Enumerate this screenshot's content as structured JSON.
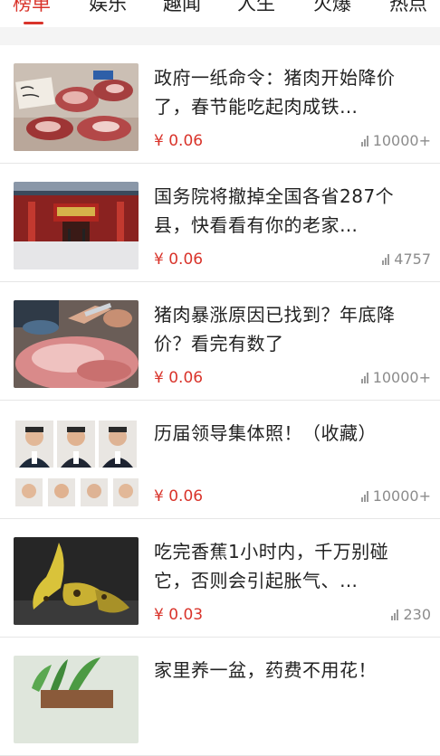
{
  "tabs": [
    {
      "label": "榜单",
      "active": true
    },
    {
      "label": "娱乐"
    },
    {
      "label": "趣闻"
    },
    {
      "label": "人生"
    },
    {
      "label": "火爆"
    },
    {
      "label": "热点"
    }
  ],
  "colors": {
    "accent": "#d9342b",
    "muted": "#8c8c8c"
  },
  "items": [
    {
      "title": "政府一纸命令：猪肉开始降价了，春节能吃起肉成铁…",
      "price": "¥ 0.06",
      "views": "10000+",
      "image": "pork-on-table"
    },
    {
      "title": "国务院将撤掉全国各省287个县，快看看有你的老家…",
      "price": "¥ 0.06",
      "views": "4757",
      "image": "government-building"
    },
    {
      "title": "猪肉暴涨原因已找到？年底降价？看完有数了",
      "price": "¥ 0.06",
      "views": "10000+",
      "image": "butcher-cutting-pork"
    },
    {
      "title": "历届领导集体照！（收藏）",
      "price": "¥ 0.06",
      "views": "10000+",
      "image": "leader-portraits"
    },
    {
      "title": "吃完香蕉1小时内，千万别碰它，否则会引起胀气、…",
      "price": "¥ 0.03",
      "views": "230",
      "image": "banana-peels"
    },
    {
      "title": "家里养一盆，药费不用花！",
      "price": "",
      "views": "",
      "image": "potted-plant"
    }
  ]
}
